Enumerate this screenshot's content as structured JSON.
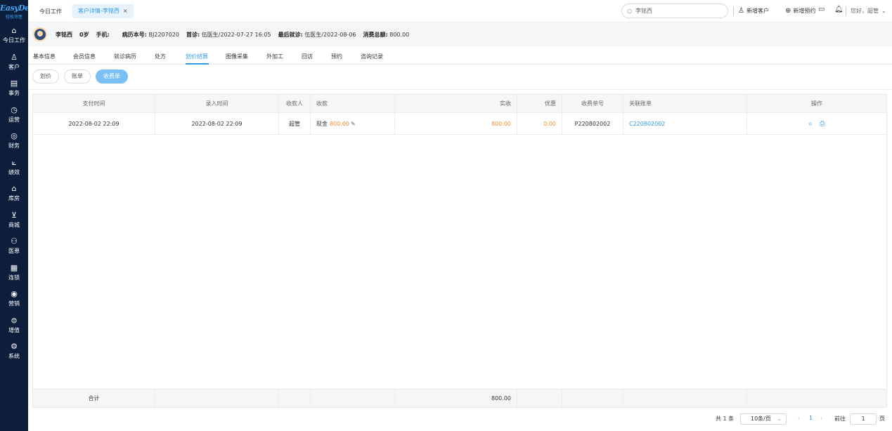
{
  "sidebar": {
    "logo_main": "EasyDent",
    "logo_sub": "轻松牙医",
    "items": [
      {
        "label": "今日工作",
        "icon": "home-icon",
        "glyph": "⌂"
      },
      {
        "label": "客户",
        "icon": "user-icon",
        "glyph": "♙"
      },
      {
        "label": "事务",
        "icon": "task-icon",
        "glyph": "▤"
      },
      {
        "label": "运营",
        "icon": "clock-icon",
        "glyph": "◷"
      },
      {
        "label": "财务",
        "icon": "finance-icon",
        "glyph": "◎"
      },
      {
        "label": "绩效",
        "icon": "chart-icon",
        "glyph": "⟀"
      },
      {
        "label": "库房",
        "icon": "warehouse-icon",
        "glyph": "⌂"
      },
      {
        "label": "商城",
        "icon": "cart-icon",
        "glyph": "⊻"
      },
      {
        "label": "医患",
        "icon": "doctor-patient-icon",
        "glyph": "⚇"
      },
      {
        "label": "连锁",
        "icon": "chain-icon",
        "glyph": "▦"
      },
      {
        "label": "营销",
        "icon": "marketing-icon",
        "glyph": "◉"
      },
      {
        "label": "增值",
        "icon": "value-added-icon",
        "glyph": "⊜"
      },
      {
        "label": "系统",
        "icon": "settings-icon",
        "glyph": "⚙"
      }
    ]
  },
  "topbar": {
    "home_tab": "今日工作",
    "active_tab": "客户详情-李铭西",
    "close_glyph": "×",
    "search_value": "李铭西",
    "new_customer": "新增客户",
    "new_appointment": "新增预约",
    "greeting": "您好，超管"
  },
  "patient": {
    "name": "李铭西",
    "age": "0岁",
    "phone_label": "手机:",
    "record_label": "病历本号:",
    "record_value": "BJ2207020",
    "first_visit_label": "首诊:",
    "first_visit_value": "伍医生/2022-07-27 16:05",
    "last_visit_label": "最后就诊:",
    "last_visit_value": "伍医生/2022-08-06",
    "total_label": "消费总额:",
    "total_value": "800.00"
  },
  "subtabs": [
    "基本信息",
    "会员信息",
    "就诊病历",
    "处方",
    "划价结算",
    "图像采集",
    "外加工",
    "回访",
    "预约",
    "咨询记录"
  ],
  "active_subtab": "划价结算",
  "pills": {
    "pricing": "划价",
    "bill": "账单",
    "receipt": "收费单"
  },
  "table": {
    "headers": [
      "支付时间",
      "录入时间",
      "收款人",
      "收款",
      "实收",
      "优惠",
      "收费单号",
      "关联账单",
      "操作"
    ],
    "row": {
      "pay_time": "2022-08-02 22:09",
      "entry_time": "2022-08-02 22:09",
      "payee": "超管",
      "method": "现金",
      "amount": "800.00",
      "received": "800.00",
      "discount": "0.00",
      "receipt_no": "P220802002",
      "linked_bill": "C220802002"
    },
    "footer": {
      "label": "合计",
      "received_total": "800.00"
    }
  },
  "pagination": {
    "total": "共 1 条",
    "page_size": "10条/页",
    "current_page": "1",
    "goto_label": "前往",
    "goto_value": "1",
    "page_unit": "页",
    "prev": "‹",
    "next": "›"
  },
  "colors": {
    "sidebar_bg": "#0d1e3d",
    "accent": "#2f9ae6",
    "orange": "#f08d2c"
  }
}
